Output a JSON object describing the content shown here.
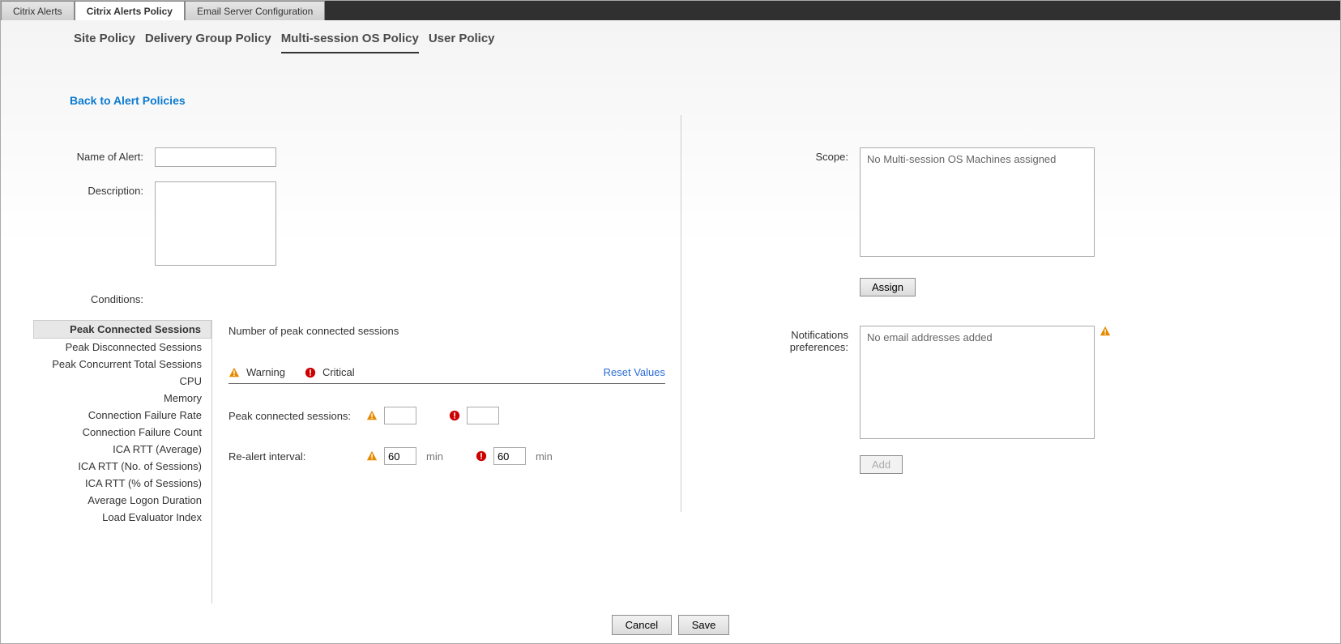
{
  "topTabs": [
    {
      "label": "Citrix Alerts",
      "active": false
    },
    {
      "label": "Citrix Alerts Policy",
      "active": true
    },
    {
      "label": "Email Server Configuration",
      "active": false
    }
  ],
  "subTabs": [
    {
      "label": "Site Policy",
      "active": false
    },
    {
      "label": "Delivery Group Policy",
      "active": false
    },
    {
      "label": "Multi-session OS Policy",
      "active": true
    },
    {
      "label": "User Policy",
      "active": false
    }
  ],
  "backLink": "Back to Alert Policies",
  "labels": {
    "name": "Name of Alert:",
    "description": "Description:",
    "conditions": "Conditions:",
    "scope": "Scope:",
    "assign": "Assign",
    "notifPref": "Notifications preferences:",
    "add": "Add",
    "cancel": "Cancel",
    "save": "Save"
  },
  "fields": {
    "name": "",
    "description": "",
    "scopeText": "No Multi-session OS Machines assigned",
    "notifText": "No email addresses added"
  },
  "conditions": [
    {
      "label": "Peak Connected Sessions",
      "selected": true
    },
    {
      "label": "Peak Disconnected Sessions"
    },
    {
      "label": "Peak Concurrent Total Sessions"
    },
    {
      "label": "CPU"
    },
    {
      "label": "Memory"
    },
    {
      "label": "Connection Failure Rate"
    },
    {
      "label": "Connection Failure Count"
    },
    {
      "label": "ICA RTT (Average)"
    },
    {
      "label": "ICA RTT (No. of Sessions)"
    },
    {
      "label": "ICA RTT (% of Sessions)"
    },
    {
      "label": "Average Logon Duration"
    },
    {
      "label": "Load Evaluator Index"
    }
  ],
  "detail": {
    "desc": "Number of peak connected sessions",
    "warningLabel": "Warning",
    "criticalLabel": "Critical",
    "reset": "Reset Values",
    "rows": [
      {
        "label": "Peak connected sessions:",
        "warn": "",
        "crit": "",
        "unit": ""
      },
      {
        "label": "Re-alert interval:",
        "warn": "60",
        "crit": "60",
        "unit": "min"
      }
    ]
  }
}
